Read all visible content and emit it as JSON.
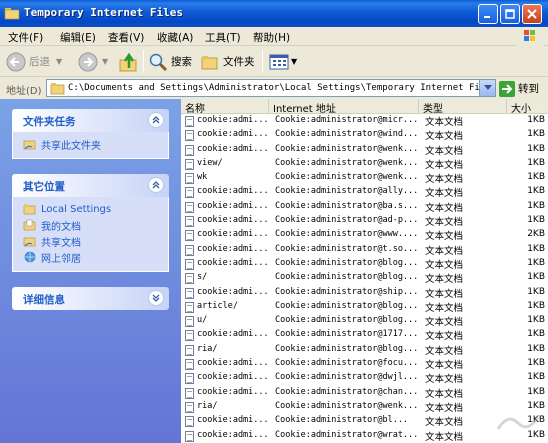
{
  "window": {
    "title": "Temporary Internet Files"
  },
  "menu": [
    "文件(F)",
    "编辑(E)",
    "查看(V)",
    "收藏(A)",
    "工具(T)",
    "帮助(H)"
  ],
  "toolbar": {
    "back_label": "后退",
    "search_label": "搜索",
    "folders_label": "文件夹"
  },
  "address": {
    "label": "地址(D)",
    "path": "C:\\Documents and Settings\\Administrator\\Local Settings\\Temporary Internet Files",
    "go_label": "转到"
  },
  "sidebar": {
    "file_tasks": {
      "title": "文件夹任务",
      "items": [
        "共享此文件夹"
      ]
    },
    "other_places": {
      "title": "其它位置",
      "items": [
        "Local Settings",
        "我的文档",
        "共享文档",
        "网上邻居"
      ]
    },
    "details": {
      "title": "详细信息"
    }
  },
  "columns": {
    "name": "名称",
    "address": "Internet 地址",
    "type": "类型",
    "size": "大小"
  },
  "files": [
    {
      "name": "cookie:admi...",
      "address": "Cookie:administrator@micr...",
      "type": "文本文档",
      "size": "1KB"
    },
    {
      "name": "cookie:admi...",
      "address": "Cookie:administrator@wind...",
      "type": "文本文档",
      "size": "1KB"
    },
    {
      "name": "cookie:admi...",
      "address": "Cookie:administrator@wenk...",
      "type": "文本文档",
      "size": "1KB"
    },
    {
      "name": "view/",
      "address": "Cookie:administrator@wenk...",
      "type": "文本文档",
      "size": "1KB"
    },
    {
      "name": "wk",
      "address": "Cookie:administrator@wenk...",
      "type": "文本文档",
      "size": "1KB"
    },
    {
      "name": "cookie:admi...",
      "address": "Cookie:administrator@ally...",
      "type": "文本文档",
      "size": "1KB"
    },
    {
      "name": "cookie:admi...",
      "address": "Cookie:administrator@ba.s...",
      "type": "文本文档",
      "size": "1KB"
    },
    {
      "name": "cookie:admi...",
      "address": "Cookie:administrator@ad-p...",
      "type": "文本文档",
      "size": "1KB"
    },
    {
      "name": "cookie:admi...",
      "address": "Cookie:administrator@www....",
      "type": "文本文档",
      "size": "2KB"
    },
    {
      "name": "cookie:admi...",
      "address": "Cookie:administrator@t.so...",
      "type": "文本文档",
      "size": "1KB"
    },
    {
      "name": "cookie:admi...",
      "address": "Cookie:administrator@blog...",
      "type": "文本文档",
      "size": "1KB"
    },
    {
      "name": "s/",
      "address": "Cookie:administrator@blog...",
      "type": "文本文档",
      "size": "1KB"
    },
    {
      "name": "cookie:admi...",
      "address": "Cookie:administrator@ship...",
      "type": "文本文档",
      "size": "1KB"
    },
    {
      "name": "article/",
      "address": "Cookie:administrator@blog...",
      "type": "文本文档",
      "size": "1KB"
    },
    {
      "name": "u/",
      "address": "Cookie:administrator@blog...",
      "type": "文本文档",
      "size": "1KB"
    },
    {
      "name": "cookie:admi...",
      "address": "Cookie:administrator@1717...",
      "type": "文本文档",
      "size": "1KB"
    },
    {
      "name": "ria/",
      "address": "Cookie:administrator@blog...",
      "type": "文本文档",
      "size": "1KB"
    },
    {
      "name": "cookie:admi...",
      "address": "Cookie:administrator@focu...",
      "type": "文本文档",
      "size": "1KB"
    },
    {
      "name": "cookie:admi...",
      "address": "Cookie:administrator@dwjl...",
      "type": "文本文档",
      "size": "1KB"
    },
    {
      "name": "cookie:admi...",
      "address": "Cookie:administrator@chan...",
      "type": "文本文档",
      "size": "1KB"
    },
    {
      "name": "ria/",
      "address": "Cookie:administrator@wenk...",
      "type": "文本文档",
      "size": "1KB"
    },
    {
      "name": "cookie:admi...",
      "address": "Cookie:administrator@bl...",
      "type": "文本文档",
      "size": "1KB"
    },
    {
      "name": "cookie:admi...",
      "address": "Cookie:administrator@wrat...",
      "type": "文本文档",
      "size": "1KB"
    }
  ]
}
